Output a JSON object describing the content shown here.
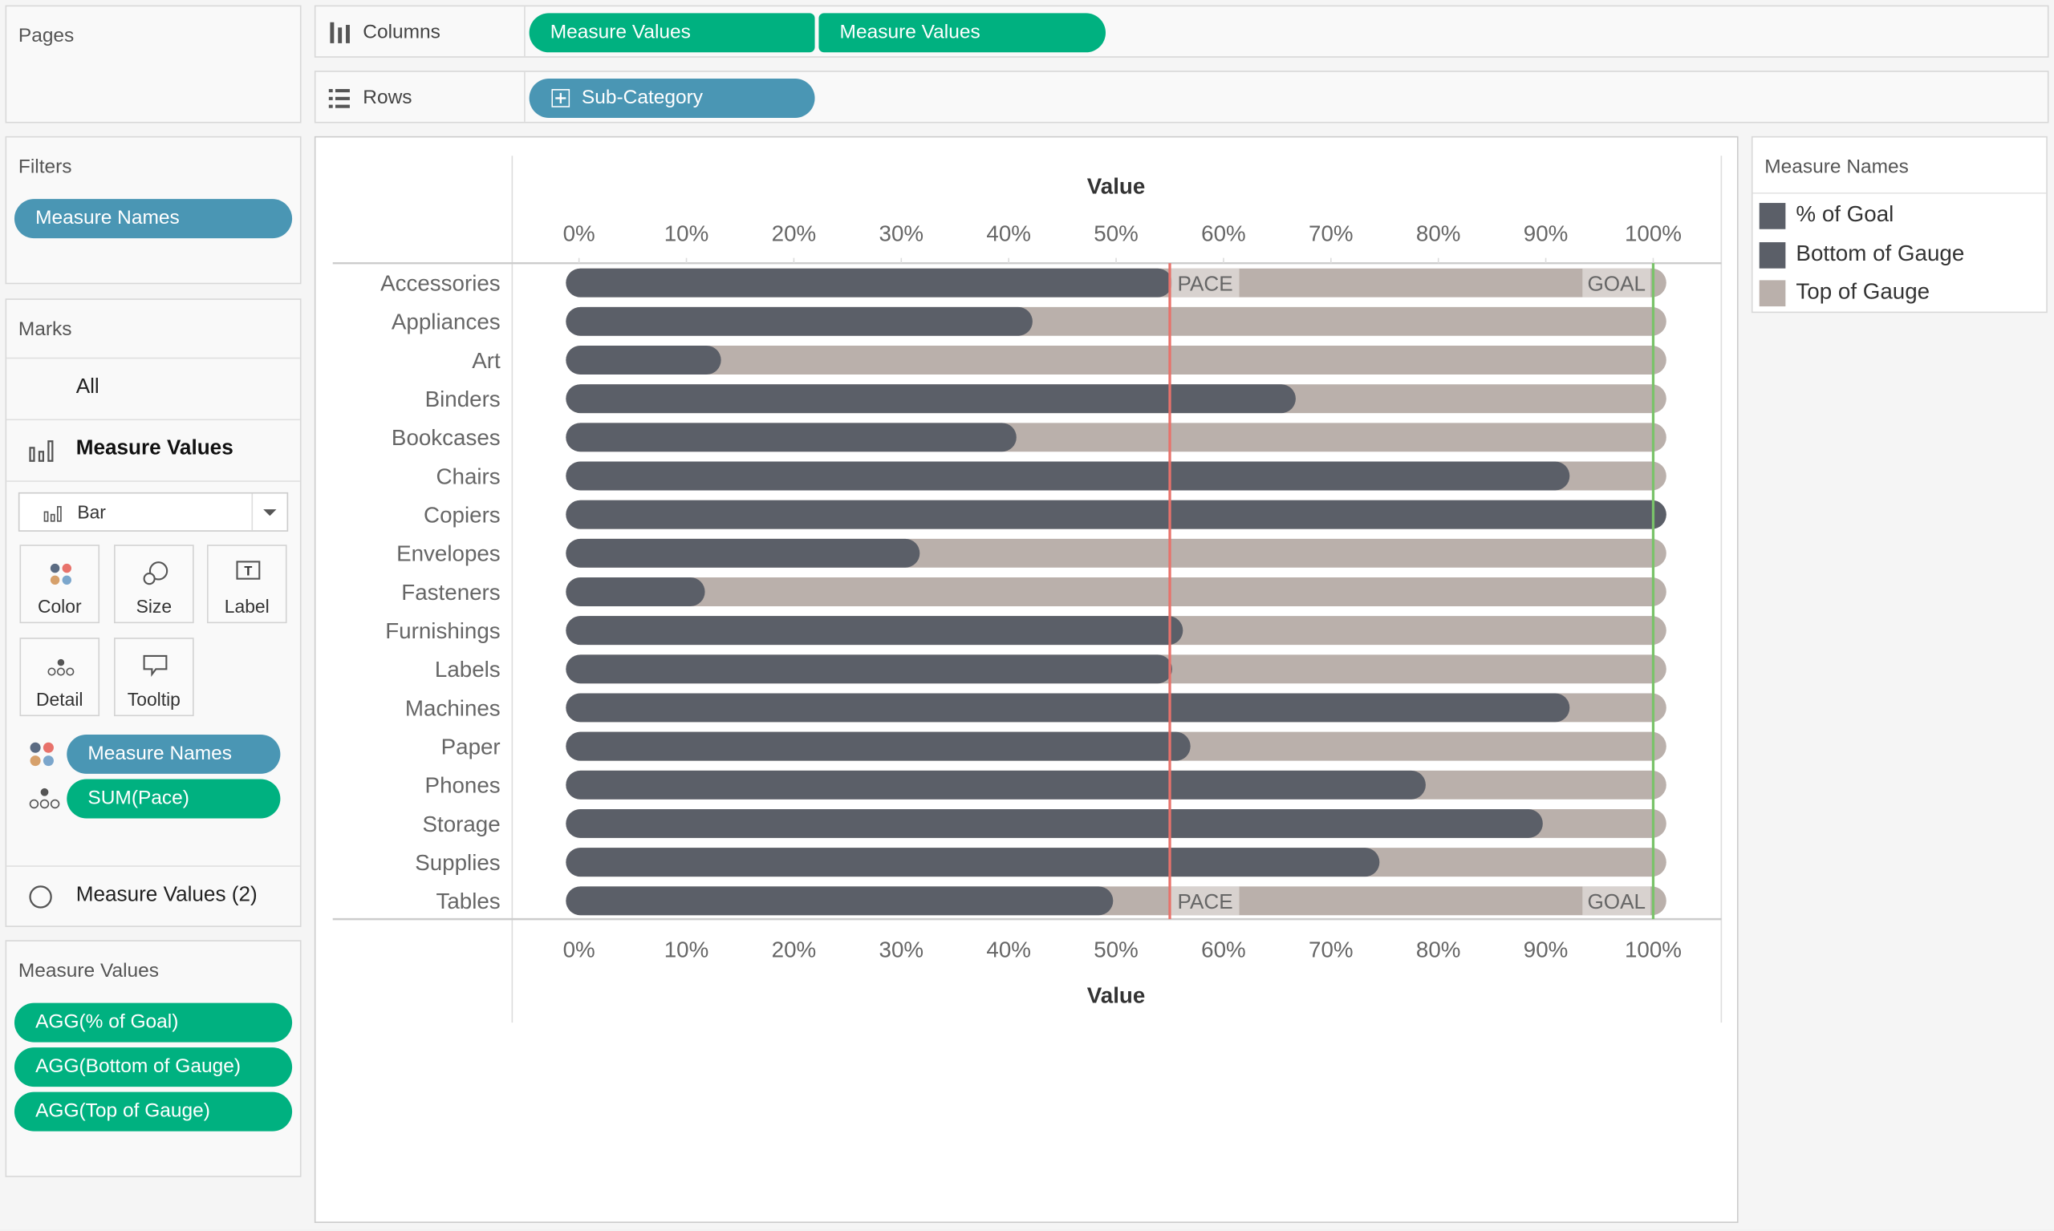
{
  "pages": {
    "title": "Pages"
  },
  "filters": {
    "title": "Filters",
    "pills": [
      "Measure Names"
    ]
  },
  "marks": {
    "title": "Marks",
    "all_label": "All",
    "card_label": "Measure Values",
    "mark_type": "Bar",
    "buttons": [
      "Color",
      "Size",
      "Label",
      "Detail",
      "Tooltip"
    ],
    "pills": [
      {
        "label": "Measure Names",
        "role": "color"
      },
      {
        "label": "SUM(Pace)",
        "role": "detail"
      }
    ],
    "secondary_card": "Measure Values (2)"
  },
  "measure_values": {
    "title": "Measure Values",
    "pills": [
      "AGG(% of Goal)",
      "AGG(Bottom of Gauge)",
      "AGG(Top of Gauge)"
    ]
  },
  "shelves": {
    "columns": {
      "label": "Columns",
      "pills": [
        "Measure Values",
        "Measure Values"
      ]
    },
    "rows": {
      "label": "Rows",
      "pills": [
        "Sub-Category"
      ]
    }
  },
  "legend": {
    "title": "Measure Names",
    "items": [
      {
        "label": "% of Goal",
        "color": "#5b5f68"
      },
      {
        "label": "Bottom of Gauge",
        "color": "#5b5f68"
      },
      {
        "label": "Top of Gauge",
        "color": "#bab0ab"
      }
    ]
  },
  "chart_data": {
    "type": "bar",
    "orientation": "horizontal",
    "xlabel": "Value",
    "xlim": [
      0,
      1
    ],
    "ticks": [
      "0%",
      "10%",
      "20%",
      "30%",
      "40%",
      "50%",
      "60%",
      "70%",
      "80%",
      "90%",
      "100%"
    ],
    "categories": [
      "Accessories",
      "Appliances",
      "Art",
      "Binders",
      "Bookcases",
      "Chairs",
      "Copiers",
      "Envelopes",
      "Fasteners",
      "Furnishings",
      "Labels",
      "Machines",
      "Paper",
      "Phones",
      "Storage",
      "Supplies",
      "Tables"
    ],
    "series": [
      {
        "name": "% of Goal",
        "color": "#5b5f68",
        "values": [
          0.54,
          0.41,
          0.12,
          0.655,
          0.395,
          0.91,
          1.0,
          0.305,
          0.105,
          0.55,
          0.54,
          0.91,
          0.557,
          0.776,
          0.885,
          0.733,
          0.485
        ]
      },
      {
        "name": "Top of Gauge",
        "color": "#bab0ab",
        "values": [
          1,
          1,
          1,
          1,
          1,
          1,
          1,
          1,
          1,
          1,
          1,
          1,
          1,
          1,
          1,
          1,
          1
        ]
      }
    ],
    "reference_lines": [
      {
        "label": "PACE",
        "value": 0.55,
        "color": "#e8726b"
      },
      {
        "label": "GOAL",
        "value": 1.0,
        "color": "#7ac36a"
      }
    ],
    "grid": false
  }
}
